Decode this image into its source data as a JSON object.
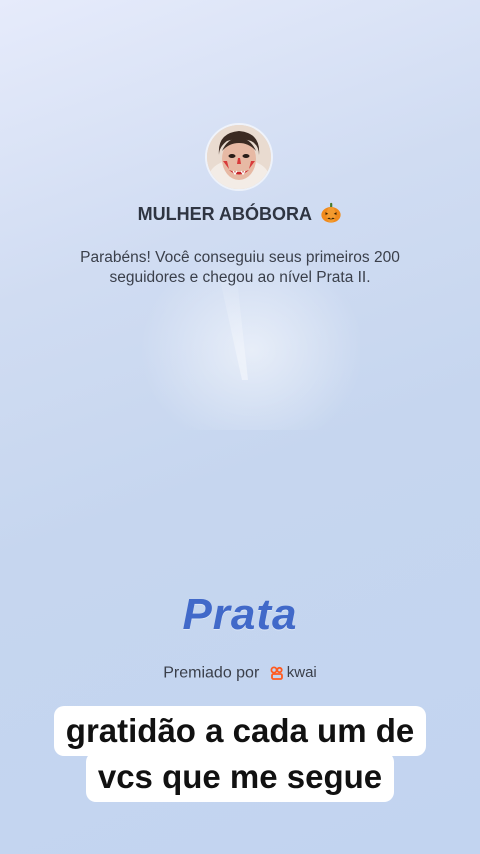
{
  "profile": {
    "name": "MULHER ABÓBORA",
    "name_icon": "pumpkin-icon",
    "message": "Parabéns! Você conseguiu seus primeiros 200 seguidores e chegou ao nível Prata II."
  },
  "level": {
    "label": "Prata"
  },
  "footer": {
    "awarded_by": "Premiado por",
    "brand": "kwai",
    "brand_color": "#ff5a1f"
  },
  "caption": {
    "line1": "gratidão a cada um de",
    "line2": "vcs que me segue"
  },
  "colors": {
    "level_text": "#4169c9",
    "background": "#c8d8f0"
  }
}
